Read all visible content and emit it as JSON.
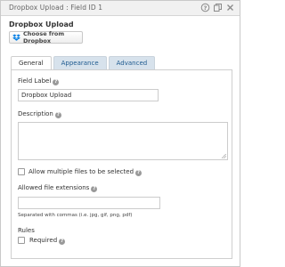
{
  "titlebar": {
    "title": "Dropbox Upload : Field ID 1",
    "icons": [
      "help-icon",
      "duplicate-icon",
      "close-icon"
    ]
  },
  "field_type_title": "Dropbox Upload",
  "choose_button": {
    "label": "Choose from Dropbox",
    "icon": "dropbox-icon"
  },
  "tabs": [
    {
      "label": "General",
      "active": true
    },
    {
      "label": "Appearance",
      "active": false
    },
    {
      "label": "Advanced",
      "active": false
    }
  ],
  "general": {
    "field_label": {
      "label": "Field Label",
      "value": "Dropbox Upload"
    },
    "description": {
      "label": "Description",
      "value": ""
    },
    "multiple_files": {
      "label": "Allow multiple files to be selected",
      "checked": false
    },
    "extensions": {
      "label": "Allowed file extensions",
      "value": "",
      "note": "Separated with commas (i.e. jpg, gif, png, pdf)"
    },
    "rules": {
      "label": "Rules",
      "required_label": "Required",
      "required_checked": false
    }
  },
  "colors": {
    "tab_inactive_bg": "#d7e2ec",
    "tab_inactive_text": "#1e5a8f",
    "dropbox_blue": "#007ee5"
  }
}
